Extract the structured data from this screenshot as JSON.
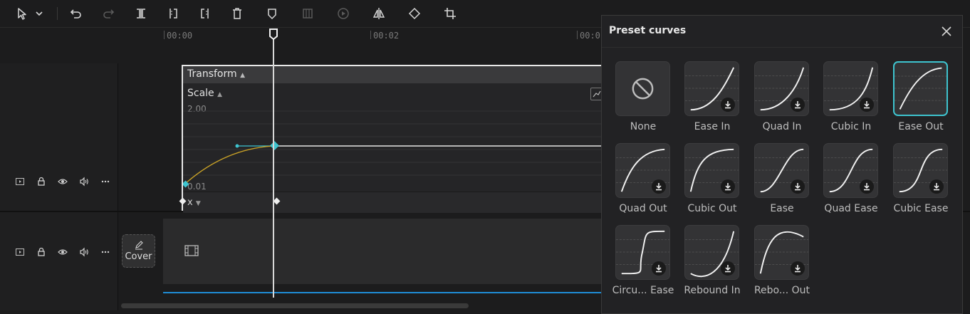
{
  "ruler": {
    "t0": "00:00",
    "t1": "00:02",
    "t2": "00:0"
  },
  "keyframe_editor": {
    "section": "Transform",
    "property": "Scale",
    "max_value": "2.00",
    "min_value": "0.01",
    "axis": "x"
  },
  "track2": {
    "cover_label": "Cover"
  },
  "panel": {
    "title": "Preset curves",
    "presets": [
      {
        "label": "None",
        "curve": "none",
        "selected": false
      },
      {
        "label": "Ease In",
        "curve": "ease-in",
        "selected": false
      },
      {
        "label": "Quad In",
        "curve": "quad-in",
        "selected": false
      },
      {
        "label": "Cubic In",
        "curve": "cubic-in",
        "selected": false
      },
      {
        "label": "Ease Out",
        "curve": "ease-out",
        "selected": true
      },
      {
        "label": "Quad Out",
        "curve": "quad-out",
        "selected": false
      },
      {
        "label": "Cubic Out",
        "curve": "cubic-out",
        "selected": false
      },
      {
        "label": "Ease",
        "curve": "ease",
        "selected": false
      },
      {
        "label": "Quad Ease",
        "curve": "quad-ease",
        "selected": false
      },
      {
        "label": "Cubic Ease",
        "curve": "cubic-ease",
        "selected": false
      },
      {
        "label": "Circu... Ease",
        "curve": "circ-ease",
        "selected": false
      },
      {
        "label": "Rebound In",
        "curve": "rebound-in",
        "selected": false
      },
      {
        "label": "Rebo... Out",
        "curve": "rebound-out",
        "selected": false
      }
    ]
  },
  "colors": {
    "accent": "#3ec4cf",
    "curve_gold": "#c9a227",
    "timeline_blue": "#1f8dd6"
  }
}
